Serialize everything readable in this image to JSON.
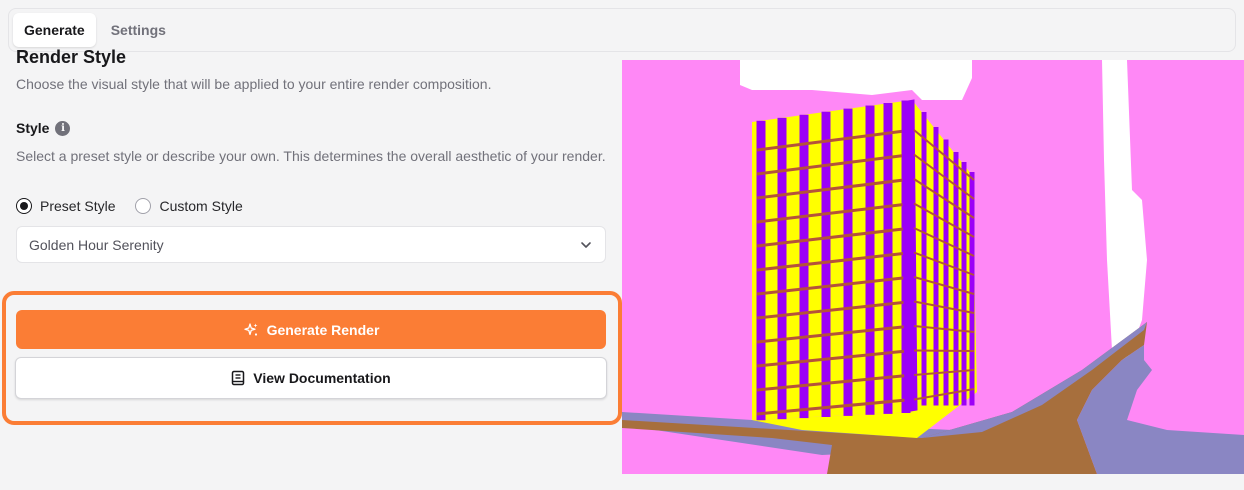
{
  "tabs": [
    {
      "label": "Generate",
      "active": true
    },
    {
      "label": "Settings",
      "active": false
    }
  ],
  "section": {
    "title": "Render Style",
    "subtitle": "Choose the visual style that will be applied to your entire render composition."
  },
  "style": {
    "label": "Style",
    "help": "Select a preset style or describe your own. This determines the overall aesthetic of your render.",
    "options": [
      {
        "label": "Preset Style",
        "checked": true
      },
      {
        "label": "Custom Style",
        "checked": false
      }
    ],
    "selected_preset": "Golden Hour Serenity"
  },
  "actions": {
    "generate_label": "Generate Render",
    "docs_label": "View Documentation",
    "highlight_color": "#fb7d35"
  },
  "preview": {
    "colors": {
      "sky": "#ff88f6",
      "building_face": "#ffff00",
      "mullion": "#9b00f7",
      "road": "#a76f3d",
      "sidewalk": "#8a86c3"
    }
  }
}
